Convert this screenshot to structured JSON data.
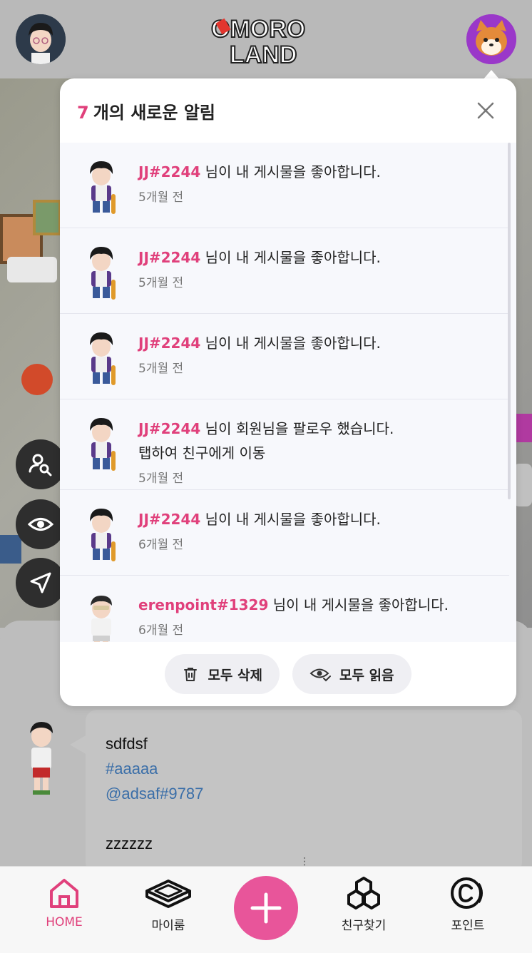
{
  "header": {
    "logo_text_line1": "OMORO",
    "logo_text_line2": "LAND"
  },
  "notifications": {
    "count": "7",
    "title": "개의 새로운 알림",
    "items": [
      {
        "user": "JJ#2244",
        "message": " 님이 내 게시물을 좋아합니다.",
        "extra": "",
        "time": "5개월 전"
      },
      {
        "user": "JJ#2244",
        "message": " 님이 내 게시물을 좋아합니다.",
        "extra": "",
        "time": "5개월 전"
      },
      {
        "user": "JJ#2244",
        "message": " 님이 내 게시물을 좋아합니다.",
        "extra": "",
        "time": "5개월 전"
      },
      {
        "user": "JJ#2244",
        "message": " 님이 회원님을 팔로우 했습니다.",
        "extra": "탭하여 친구에게 이동",
        "time": "5개월 전"
      },
      {
        "user": "JJ#2244",
        "message": " 님이 내 게시물을 좋아합니다.",
        "extra": "",
        "time": "6개월 전"
      },
      {
        "user": "erenpoint#1329",
        "message": " 님이 내 게시물을 좋아합니다.",
        "extra": "",
        "time": "6개월 전"
      }
    ],
    "delete_all_label": "모두 삭제",
    "read_all_label": "모두 읽음"
  },
  "post": {
    "line1": "sdfdsf",
    "hashtag": "#aaaaa",
    "mention": "@adsaf#9787",
    "line4": "zzzzzz"
  },
  "nav": {
    "home": "HOME",
    "myroom": "마이룸",
    "find_friends": "친구찾기",
    "points": "포인트"
  },
  "colors": {
    "accent": "#e0407b",
    "plus_button": "#e8559a",
    "link": "#3a6ea8"
  }
}
